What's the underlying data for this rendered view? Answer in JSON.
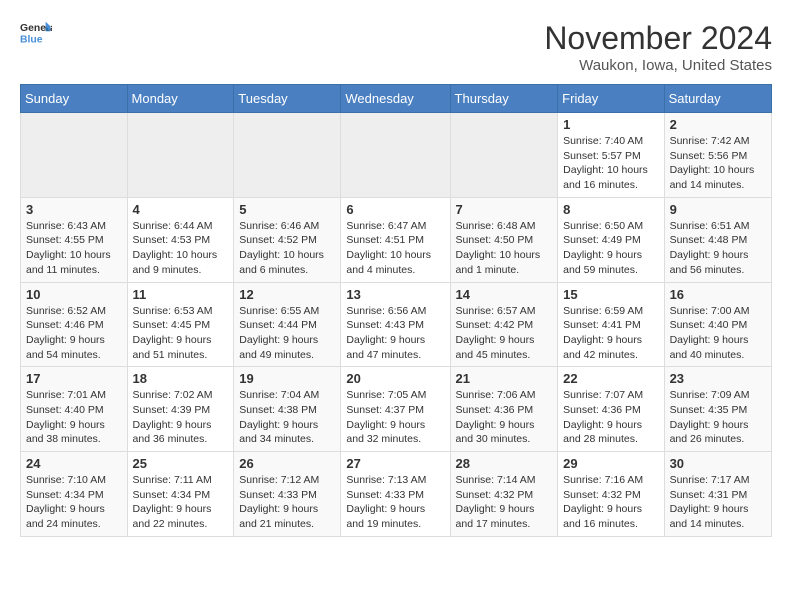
{
  "logo": {
    "text_general": "General",
    "text_blue": "Blue"
  },
  "header": {
    "month": "November 2024",
    "location": "Waukon, Iowa, United States"
  },
  "days_of_week": [
    "Sunday",
    "Monday",
    "Tuesday",
    "Wednesday",
    "Thursday",
    "Friday",
    "Saturday"
  ],
  "weeks": [
    [
      {
        "day": "",
        "info": ""
      },
      {
        "day": "",
        "info": ""
      },
      {
        "day": "",
        "info": ""
      },
      {
        "day": "",
        "info": ""
      },
      {
        "day": "",
        "info": ""
      },
      {
        "day": "1",
        "info": "Sunrise: 7:40 AM\nSunset: 5:57 PM\nDaylight: 10 hours\nand 16 minutes."
      },
      {
        "day": "2",
        "info": "Sunrise: 7:42 AM\nSunset: 5:56 PM\nDaylight: 10 hours\nand 14 minutes."
      }
    ],
    [
      {
        "day": "3",
        "info": "Sunrise: 6:43 AM\nSunset: 4:55 PM\nDaylight: 10 hours\nand 11 minutes."
      },
      {
        "day": "4",
        "info": "Sunrise: 6:44 AM\nSunset: 4:53 PM\nDaylight: 10 hours\nand 9 minutes."
      },
      {
        "day": "5",
        "info": "Sunrise: 6:46 AM\nSunset: 4:52 PM\nDaylight: 10 hours\nand 6 minutes."
      },
      {
        "day": "6",
        "info": "Sunrise: 6:47 AM\nSunset: 4:51 PM\nDaylight: 10 hours\nand 4 minutes."
      },
      {
        "day": "7",
        "info": "Sunrise: 6:48 AM\nSunset: 4:50 PM\nDaylight: 10 hours\nand 1 minute."
      },
      {
        "day": "8",
        "info": "Sunrise: 6:50 AM\nSunset: 4:49 PM\nDaylight: 9 hours\nand 59 minutes."
      },
      {
        "day": "9",
        "info": "Sunrise: 6:51 AM\nSunset: 4:48 PM\nDaylight: 9 hours\nand 56 minutes."
      }
    ],
    [
      {
        "day": "10",
        "info": "Sunrise: 6:52 AM\nSunset: 4:46 PM\nDaylight: 9 hours\nand 54 minutes."
      },
      {
        "day": "11",
        "info": "Sunrise: 6:53 AM\nSunset: 4:45 PM\nDaylight: 9 hours\nand 51 minutes."
      },
      {
        "day": "12",
        "info": "Sunrise: 6:55 AM\nSunset: 4:44 PM\nDaylight: 9 hours\nand 49 minutes."
      },
      {
        "day": "13",
        "info": "Sunrise: 6:56 AM\nSunset: 4:43 PM\nDaylight: 9 hours\nand 47 minutes."
      },
      {
        "day": "14",
        "info": "Sunrise: 6:57 AM\nSunset: 4:42 PM\nDaylight: 9 hours\nand 45 minutes."
      },
      {
        "day": "15",
        "info": "Sunrise: 6:59 AM\nSunset: 4:41 PM\nDaylight: 9 hours\nand 42 minutes."
      },
      {
        "day": "16",
        "info": "Sunrise: 7:00 AM\nSunset: 4:40 PM\nDaylight: 9 hours\nand 40 minutes."
      }
    ],
    [
      {
        "day": "17",
        "info": "Sunrise: 7:01 AM\nSunset: 4:40 PM\nDaylight: 9 hours\nand 38 minutes."
      },
      {
        "day": "18",
        "info": "Sunrise: 7:02 AM\nSunset: 4:39 PM\nDaylight: 9 hours\nand 36 minutes."
      },
      {
        "day": "19",
        "info": "Sunrise: 7:04 AM\nSunset: 4:38 PM\nDaylight: 9 hours\nand 34 minutes."
      },
      {
        "day": "20",
        "info": "Sunrise: 7:05 AM\nSunset: 4:37 PM\nDaylight: 9 hours\nand 32 minutes."
      },
      {
        "day": "21",
        "info": "Sunrise: 7:06 AM\nSunset: 4:36 PM\nDaylight: 9 hours\nand 30 minutes."
      },
      {
        "day": "22",
        "info": "Sunrise: 7:07 AM\nSunset: 4:36 PM\nDaylight: 9 hours\nand 28 minutes."
      },
      {
        "day": "23",
        "info": "Sunrise: 7:09 AM\nSunset: 4:35 PM\nDaylight: 9 hours\nand 26 minutes."
      }
    ],
    [
      {
        "day": "24",
        "info": "Sunrise: 7:10 AM\nSunset: 4:34 PM\nDaylight: 9 hours\nand 24 minutes."
      },
      {
        "day": "25",
        "info": "Sunrise: 7:11 AM\nSunset: 4:34 PM\nDaylight: 9 hours\nand 22 minutes."
      },
      {
        "day": "26",
        "info": "Sunrise: 7:12 AM\nSunset: 4:33 PM\nDaylight: 9 hours\nand 21 minutes."
      },
      {
        "day": "27",
        "info": "Sunrise: 7:13 AM\nSunset: 4:33 PM\nDaylight: 9 hours\nand 19 minutes."
      },
      {
        "day": "28",
        "info": "Sunrise: 7:14 AM\nSunset: 4:32 PM\nDaylight: 9 hours\nand 17 minutes."
      },
      {
        "day": "29",
        "info": "Sunrise: 7:16 AM\nSunset: 4:32 PM\nDaylight: 9 hours\nand 16 minutes."
      },
      {
        "day": "30",
        "info": "Sunrise: 7:17 AM\nSunset: 4:31 PM\nDaylight: 9 hours\nand 14 minutes."
      }
    ]
  ]
}
